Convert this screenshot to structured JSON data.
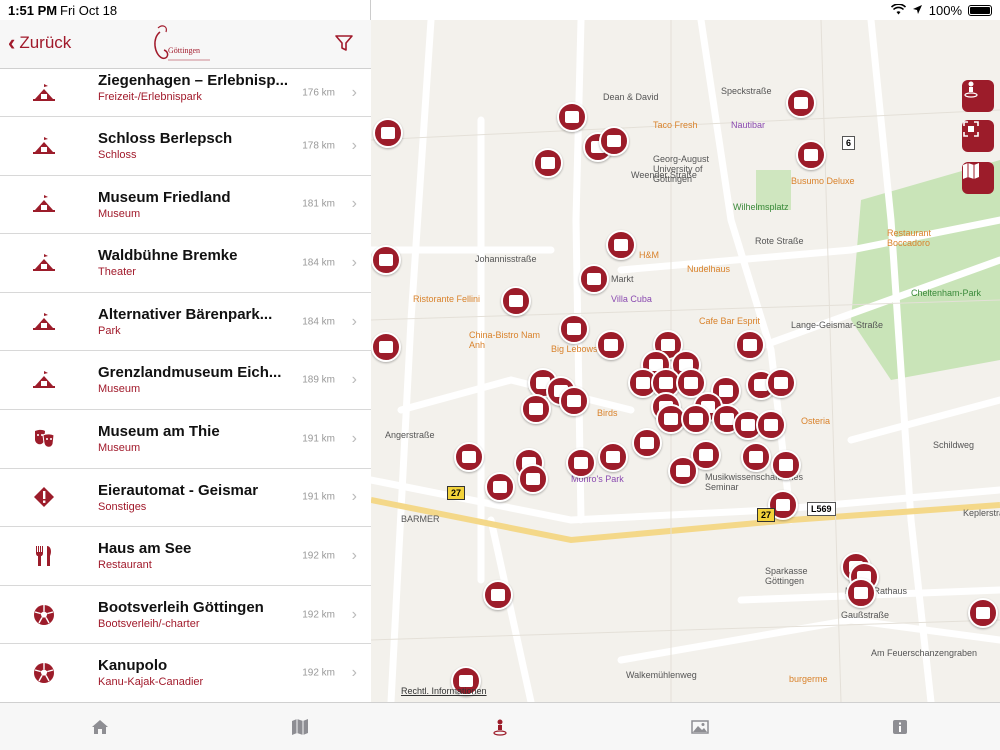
{
  "status": {
    "time": "1:51 PM",
    "date": "Fri Oct 18",
    "battery": "100%"
  },
  "nav": {
    "back_label": "Zurück",
    "logo_text": "Göttingen"
  },
  "list": [
    {
      "title": "Ziegenhagen – Erlebnisp...",
      "category": "Freizeit-/Erlebnispark",
      "distance": "176 km",
      "icon": "landmark-icon"
    },
    {
      "title": "Schloss Berlepsch",
      "category": "Schloss",
      "distance": "178 km",
      "icon": "landmark-icon"
    },
    {
      "title": "Museum Friedland",
      "category": "Museum",
      "distance": "181 km",
      "icon": "landmark-icon"
    },
    {
      "title": "Waldbühne Bremke",
      "category": "Theater",
      "distance": "184 km",
      "icon": "landmark-icon"
    },
    {
      "title": "Alternativer Bärenpark...",
      "category": "Park",
      "distance": "184 km",
      "icon": "landmark-icon"
    },
    {
      "title": "Grenzlandmuseum Eich...",
      "category": "Museum",
      "distance": "189 km",
      "icon": "landmark-icon"
    },
    {
      "title": "Museum am Thie",
      "category": "Museum",
      "distance": "191 km",
      "icon": "theater-masks-icon"
    },
    {
      "title": "Eierautomat - Geismar",
      "category": "Sonstiges",
      "distance": "191 km",
      "icon": "exclamation-marker-icon"
    },
    {
      "title": "Haus am See",
      "category": "Restaurant",
      "distance": "192 km",
      "icon": "fork-knife-icon"
    },
    {
      "title": "Bootsverleih Göttingen",
      "category": "Bootsverleih/-charter",
      "distance": "192 km",
      "icon": "soccer-ball-icon"
    },
    {
      "title": "Kanupolo",
      "category": "Kanu-Kajak-Canadier",
      "distance": "192 km",
      "icon": "soccer-ball-icon"
    }
  ],
  "map": {
    "labels": [
      {
        "text": "Dean & David",
        "cls": ""
      },
      {
        "text": "Taco Fresh",
        "cls": "poi"
      },
      {
        "text": "Nautibar",
        "cls": "purple"
      },
      {
        "text": "Georg-August University of Göttingen",
        "cls": ""
      },
      {
        "text": "Busumo Deluxe",
        "cls": "poi"
      },
      {
        "text": "Wilhelmsplatz",
        "cls": "green"
      },
      {
        "text": "Restaurant Boccadoro",
        "cls": "poi"
      },
      {
        "text": "Cheltenham-Park",
        "cls": "green"
      },
      {
        "text": "Johannisstraße",
        "cls": ""
      },
      {
        "text": "H&M",
        "cls": "poi"
      },
      {
        "text": "Nudelhaus",
        "cls": "poi"
      },
      {
        "text": "Ristorante Fellini",
        "cls": "poi"
      },
      {
        "text": "Villa Cuba",
        "cls": "purple"
      },
      {
        "text": "China-Bistro Nam Anh",
        "cls": "poi"
      },
      {
        "text": "Big Lebowski",
        "cls": "poi"
      },
      {
        "text": "Cafe Bar Esprit",
        "cls": "poi"
      },
      {
        "text": "Markt",
        "cls": ""
      },
      {
        "text": "Birds",
        "cls": "poi"
      },
      {
        "text": "Osteria",
        "cls": "poi"
      },
      {
        "text": "Monro's Park",
        "cls": "purple"
      },
      {
        "text": "Musikwissenschaftliches Seminar",
        "cls": ""
      },
      {
        "text": "Schildweg",
        "cls": ""
      },
      {
        "text": "BARMER",
        "cls": ""
      },
      {
        "text": "Sparkasse Göttingen",
        "cls": ""
      },
      {
        "text": "Neues Rathaus",
        "cls": ""
      },
      {
        "text": "Gaußstraße",
        "cls": ""
      },
      {
        "text": "Keplerstraße",
        "cls": ""
      },
      {
        "text": "burgerme",
        "cls": "poi"
      },
      {
        "text": "Angerstraße",
        "cls": ""
      },
      {
        "text": "Weender Straße",
        "cls": ""
      },
      {
        "text": "Speckstraße",
        "cls": ""
      },
      {
        "text": "Rote Straße",
        "cls": ""
      },
      {
        "text": "Lange-Geismar-Straße",
        "cls": ""
      },
      {
        "text": "Am Feuerschanzengraben",
        "cls": ""
      },
      {
        "text": "Walkemühlenweg",
        "cls": ""
      }
    ],
    "legal": "Rechtl. Informationen",
    "shields": [
      "6",
      "27",
      "27",
      "L569"
    ]
  },
  "tabs": [
    {
      "name": "tab-home",
      "icon": "home-icon"
    },
    {
      "name": "tab-map",
      "icon": "map-icon"
    },
    {
      "name": "tab-poi",
      "icon": "location-person-icon"
    },
    {
      "name": "tab-gallery",
      "icon": "image-icon"
    },
    {
      "name": "tab-info",
      "icon": "info-icon"
    }
  ],
  "colors": {
    "accent": "#9c1c2a",
    "back": "#a11a2b"
  }
}
